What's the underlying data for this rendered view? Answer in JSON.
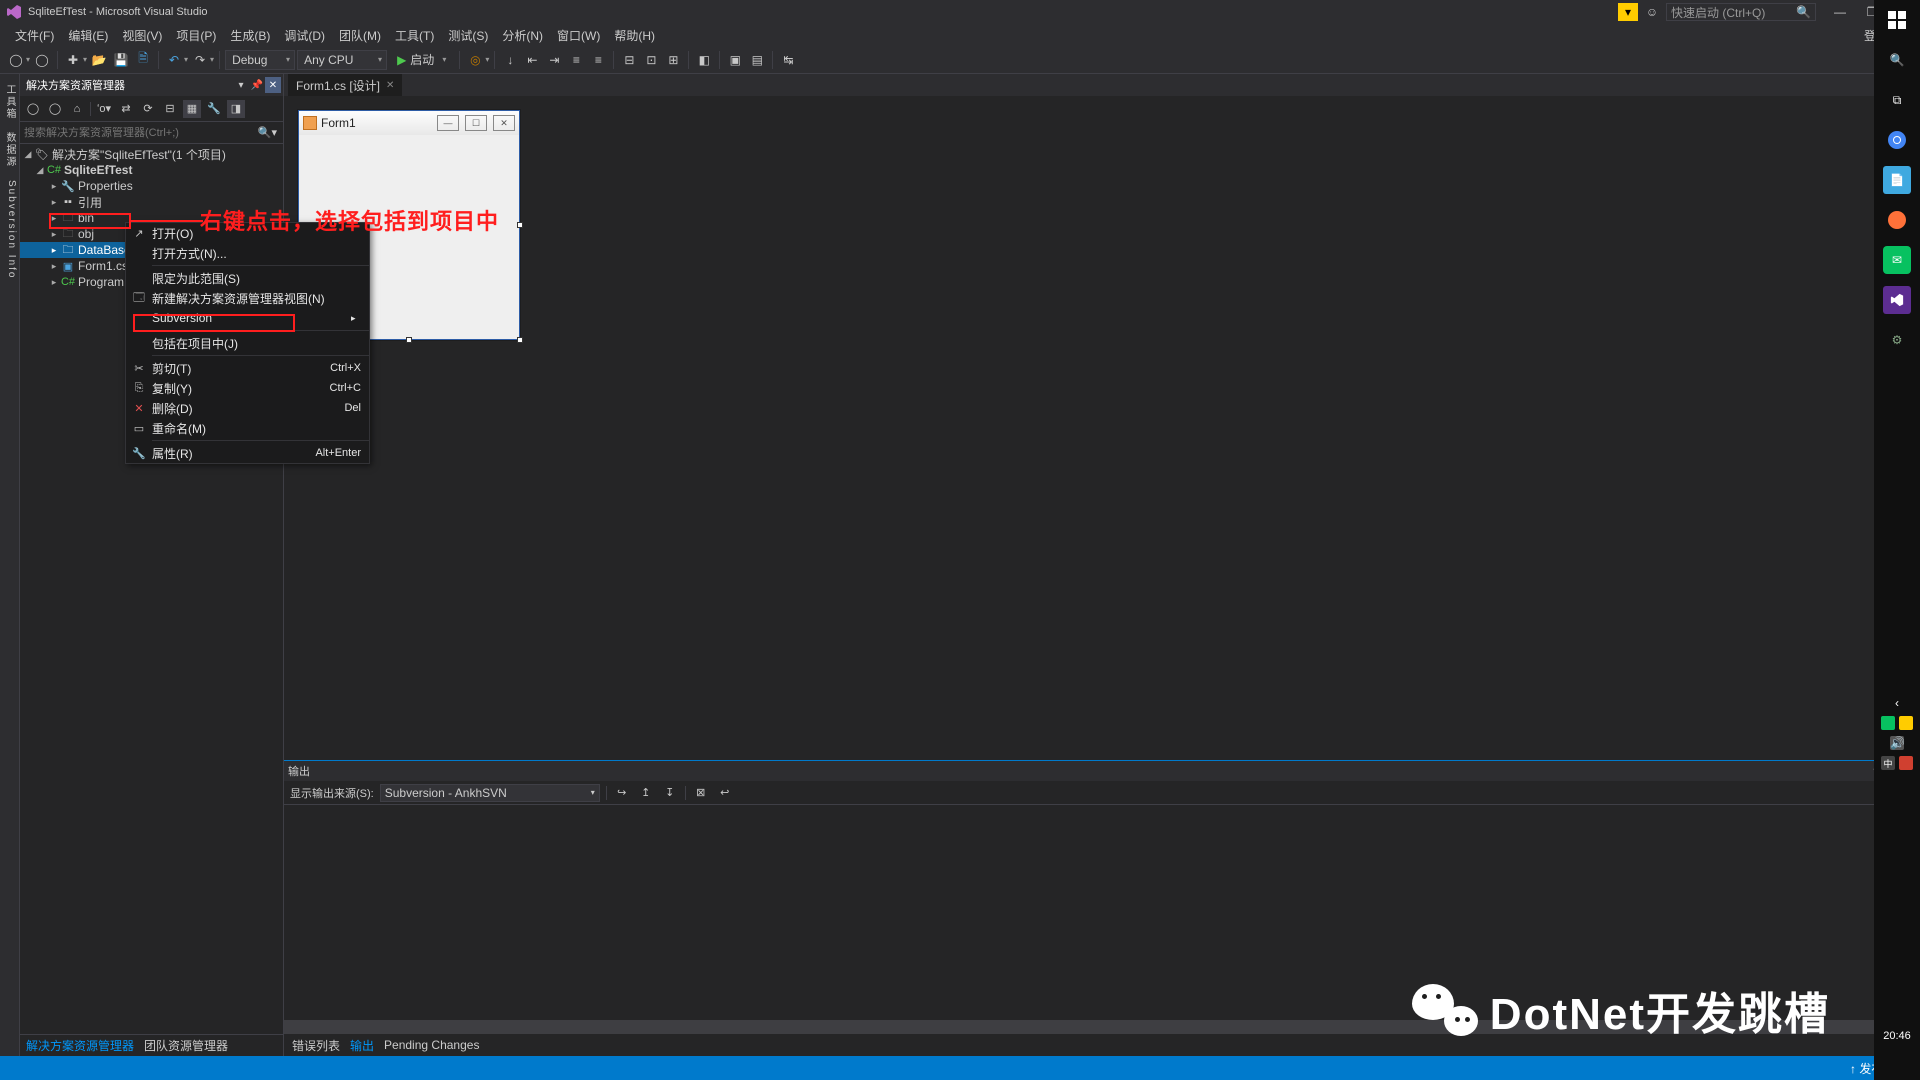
{
  "title_bar": {
    "title": "SqliteEfTest - Microsoft Visual Studio",
    "quick_launch_placeholder": "快速启动 (Ctrl+Q)"
  },
  "menu": {
    "items": [
      "文件(F)",
      "编辑(E)",
      "视图(V)",
      "项目(P)",
      "生成(B)",
      "调试(D)",
      "团队(M)",
      "工具(T)",
      "测试(S)",
      "分析(N)",
      "窗口(W)",
      "帮助(H)"
    ],
    "login": "登录"
  },
  "toolbar": {
    "config": "Debug",
    "platform": "Any CPU",
    "start": "启动"
  },
  "solution_panel": {
    "title": "解决方案资源管理器",
    "search_placeholder": "搜索解决方案资源管理器(Ctrl+;)",
    "solution_label": "解决方案\"SqliteEfTest\"(1 个项目)",
    "project": "SqliteEfTest",
    "nodes": {
      "properties": "Properties",
      "references": "引用",
      "bin": "bin",
      "obj": "obj",
      "database": "DataBase",
      "form1": "Form1.cs",
      "program": "Program.cs"
    },
    "bottom_tabs": [
      "解决方案资源管理器",
      "团队资源管理器"
    ]
  },
  "editor": {
    "tab_label": "Form1.cs [设计]",
    "form_title": "Form1"
  },
  "output": {
    "title": "输出",
    "source_label": "显示输出来源(S):",
    "source_value": "Subversion - AnkhSVN",
    "bottom_tabs": [
      "错误列表",
      "输出",
      "Pending Changes"
    ]
  },
  "statusbar": {
    "publish": "发布"
  },
  "context_menu": {
    "open": "打开(O)",
    "open_with": "打开方式(N)...",
    "scope": "限定为此范围(S)",
    "new_view": "新建解决方案资源管理器视图(N)",
    "subversion": "Subversion",
    "include": "包括在项目中(J)",
    "cut": "剪切(T)",
    "cut_sc": "Ctrl+X",
    "copy": "复制(Y)",
    "copy_sc": "Ctrl+C",
    "delete": "删除(D)",
    "delete_sc": "Del",
    "rename": "重命名(M)",
    "properties": "属性(R)",
    "properties_sc": "Alt+Enter"
  },
  "annotations": {
    "instruction": "右键点击，选择包括到项目中"
  },
  "watermark": {
    "text": "DotNet开发跳槽"
  },
  "taskbar": {
    "clock": "20:46"
  }
}
